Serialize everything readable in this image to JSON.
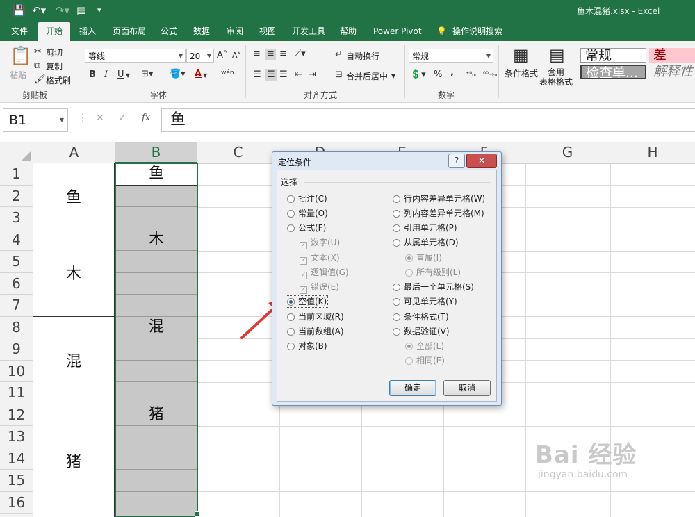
{
  "title_bar": {
    "doc_title": "鱼木混猪.xlsx  -  Excel"
  },
  "tabs": [
    "文件",
    "开始",
    "插入",
    "页面布局",
    "公式",
    "数据",
    "审阅",
    "视图",
    "开发工具",
    "帮助",
    "Power Pivot",
    "操作说明搜索"
  ],
  "ribbon": {
    "clipboard": {
      "paste": "粘贴",
      "cut": "剪切",
      "copy": "复制",
      "painter": "格式刷",
      "label": "剪贴板"
    },
    "font": {
      "name": "等线",
      "size": "20",
      "bold": "B",
      "italic": "I",
      "underline": "U",
      "font_color": "A",
      "phonetic": "wén",
      "label": "字体"
    },
    "alignment": {
      "wrap": "自动换行",
      "merge": "合并后居中",
      "label": "对齐方式"
    },
    "number": {
      "format": "常规",
      "percent": "%",
      "comma": ",",
      "label": "数字"
    },
    "styles": {
      "conditional": "条件格式",
      "table": "套用\n表格格式",
      "normal": "常规",
      "bad": "差",
      "check": "检查单...",
      "explanatory": "解释性"
    }
  },
  "formula_bar": {
    "name_box": "B1",
    "content": "鱼",
    "x": "✕",
    "check": "✓",
    "fx": "fx"
  },
  "columns": [
    "A",
    "B",
    "C",
    "D",
    "E",
    "F",
    "G",
    "H"
  ],
  "rows": [
    "1",
    "2",
    "3",
    "4",
    "5",
    "6",
    "7",
    "8",
    "9",
    "10",
    "11",
    "12",
    "13",
    "14",
    "15",
    "16"
  ],
  "cells": {
    "A1": "鱼",
    "A4": "木",
    "A8": "混",
    "A12": "猪",
    "B1": "鱼",
    "B4": "木",
    "B8": "混",
    "B12": "猪"
  },
  "dialog": {
    "title": "定位条件",
    "help": "?",
    "close": "✕",
    "group": "选择",
    "left": [
      {
        "label": "批注(C)",
        "type": "radio",
        "checked": false,
        "disabled": false
      },
      {
        "label": "常量(O)",
        "type": "radio",
        "checked": false,
        "disabled": false
      },
      {
        "label": "公式(F)",
        "type": "radio",
        "checked": false,
        "disabled": false
      },
      {
        "label": "数字(U)",
        "type": "check",
        "checked": true,
        "disabled": true
      },
      {
        "label": "文本(X)",
        "type": "check",
        "checked": true,
        "disabled": true
      },
      {
        "label": "逻辑值(G)",
        "type": "check",
        "checked": true,
        "disabled": true
      },
      {
        "label": "错误(E)",
        "type": "check",
        "checked": true,
        "disabled": true
      },
      {
        "label": "空值(K)",
        "type": "radio",
        "checked": true,
        "disabled": false
      },
      {
        "label": "当前区域(R)",
        "type": "radio",
        "checked": false,
        "disabled": false
      },
      {
        "label": "当前数组(A)",
        "type": "radio",
        "checked": false,
        "disabled": false
      },
      {
        "label": "对象(B)",
        "type": "radio",
        "checked": false,
        "disabled": false
      }
    ],
    "right": [
      {
        "label": "行内容差异单元格(W)",
        "type": "radio",
        "checked": false,
        "disabled": false
      },
      {
        "label": "列内容差异单元格(M)",
        "type": "radio",
        "checked": false,
        "disabled": false
      },
      {
        "label": "引用单元格(P)",
        "type": "radio",
        "checked": false,
        "disabled": false
      },
      {
        "label": "从属单元格(D)",
        "type": "radio",
        "checked": false,
        "disabled": false
      },
      {
        "label": "直属(I)",
        "type": "radio",
        "checked": true,
        "disabled": true
      },
      {
        "label": "所有级别(L)",
        "type": "radio",
        "checked": false,
        "disabled": true
      },
      {
        "label": "最后一个单元格(S)",
        "type": "radio",
        "checked": false,
        "disabled": false
      },
      {
        "label": "可见单元格(Y)",
        "type": "radio",
        "checked": false,
        "disabled": false
      },
      {
        "label": "条件格式(T)",
        "type": "radio",
        "checked": false,
        "disabled": false
      },
      {
        "label": "数据验证(V)",
        "type": "radio",
        "checked": false,
        "disabled": false
      },
      {
        "label": "全部(L)",
        "type": "radio",
        "checked": true,
        "disabled": true
      },
      {
        "label": "相同(E)",
        "type": "radio",
        "checked": false,
        "disabled": true
      }
    ],
    "ok": "确定",
    "cancel": "取消"
  },
  "watermark": {
    "brand": "Bai 经验",
    "url": "jingyan.baidu.com"
  },
  "colors": {
    "excel_green": "#217346",
    "arrow_red": "#e03a3a",
    "selection_gray": "#c8c8c8"
  }
}
